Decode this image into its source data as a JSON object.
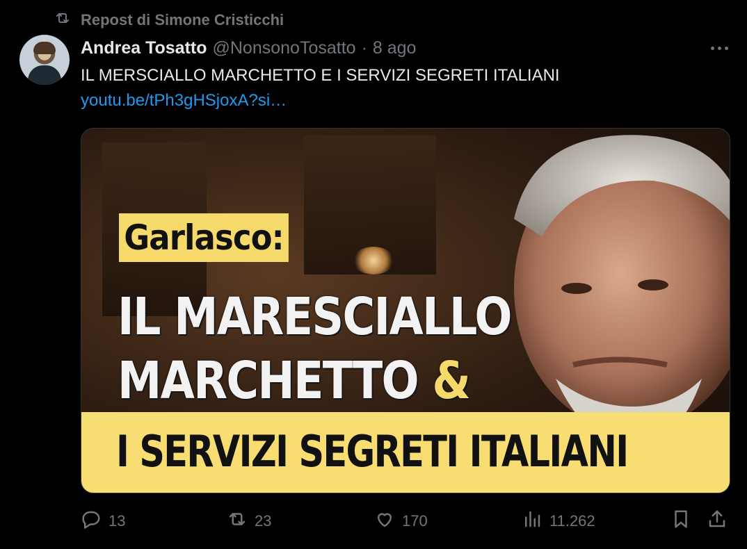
{
  "repost": {
    "icon": "repost-icon",
    "label": "Repost di Simone Cristicchi"
  },
  "tweet": {
    "author_name": "Andrea Tosatto",
    "author_handle": "@NonsonoTosatto",
    "separator": "·",
    "time": "8 ago",
    "text": "IL MERSCIALLO MARCHETTO E I SERVIZI SEGRETI ITALIANI",
    "link": "youtu.be/tPh3gHSjoxA?si…"
  },
  "media": {
    "tag": "Garlasco:",
    "line1": "IL MARESCIALLO",
    "line2": "MARCHETTO",
    "ampersand": "&",
    "banner": "I SERVIZI SEGRETI ITALIANI"
  },
  "actions": {
    "replies": "13",
    "reposts": "23",
    "likes": "170",
    "views": "11.262"
  },
  "colors": {
    "background": "#000000",
    "text": "#e7e9ea",
    "muted": "#71767b",
    "link": "#1d9bf0",
    "thumbnail_yellow": "#f7dd72"
  }
}
